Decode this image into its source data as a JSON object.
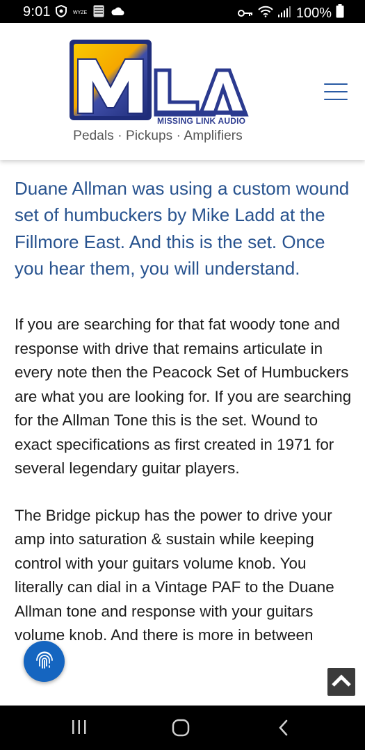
{
  "status_bar": {
    "time": "9:01",
    "battery": "100%",
    "notification_icons": [
      "vpn-shield-icon",
      "wyze-icon",
      "shopping-icon",
      "cloud-icon"
    ],
    "system_icons": [
      "key-icon",
      "wifi-icon",
      "signal-icon",
      "battery-icon"
    ]
  },
  "header": {
    "logo_letters": "MLA",
    "logo_brand": "MISSING LINK AUDIO",
    "tagline": "Pedals · Pickups · Amplifiers",
    "menu_icon": "hamburger-menu-icon",
    "colors": {
      "brand_blue": "#2b3a8f",
      "accent_yellow": "#f7c600",
      "menu_blue": "#2a5ba4"
    }
  },
  "content": {
    "lead": "Duane Allman was using a custom wound set of humbuckers by Mike Ladd at the Fillmore East. And this is the set. Once you hear them, you will understand.",
    "paragraph_1": "If you are searching for that fat woody tone and response with drive that remains articulate in every note then the Peacock Set of Humbuckers are what you are looking for. If you are searching for the Allman Tone this is the set. Wound to exact specifications as first created in 1971 for several legendary guitar players.",
    "paragraph_2": "The Bridge pickup has the power to drive your amp into saturation & sustain while keeping control with your guitars volume knob. You literally can dial in a Vintage PAF to the Duane Allman tone and response with your guitars volume knob. And there is more in between",
    "lead_color": "#28538f"
  },
  "floating": {
    "fingerprint_icon": "fingerprint-icon",
    "scroll_top_icon": "chevron-up-icon"
  },
  "nav_bar": {
    "icons": [
      "recent-apps-icon",
      "home-icon",
      "back-icon"
    ]
  }
}
